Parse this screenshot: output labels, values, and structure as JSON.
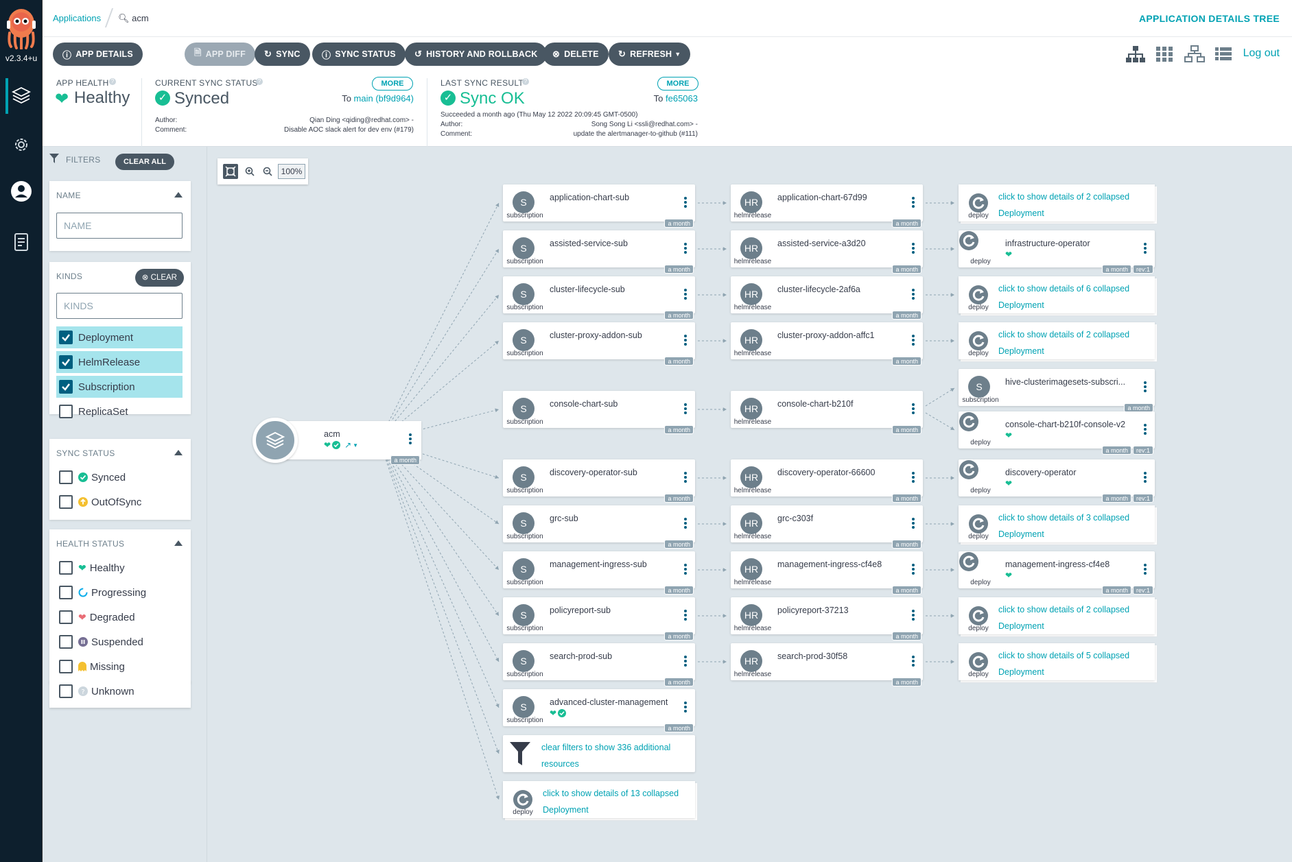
{
  "app": {
    "version": "v2.3.4+u"
  },
  "breadcrumb": {
    "applications": "Applications",
    "search_icon": "search-icon",
    "current": "acm"
  },
  "page_title": "APPLICATION DETAILS TREE",
  "toolbar": {
    "buttons": [
      {
        "label": "APP DETAILS",
        "icon": "info-icon",
        "disabled": false
      },
      {
        "label": "APP DIFF",
        "icon": "file-icon",
        "disabled": true
      },
      {
        "label": "SYNC",
        "icon": "sync-icon",
        "disabled": false
      },
      {
        "label": "SYNC STATUS",
        "icon": "info-icon",
        "disabled": false
      },
      {
        "label": "HISTORY AND ROLLBACK",
        "icon": "history-icon",
        "disabled": false
      },
      {
        "label": "DELETE",
        "icon": "times-circle-icon",
        "disabled": false
      },
      {
        "label": "REFRESH",
        "icon": "redo-icon",
        "disabled": false
      }
    ],
    "logout": "Log out"
  },
  "status": {
    "health_label": "APP HEALTH",
    "health_value": "Healthy",
    "sync_label": "CURRENT SYNC STATUS",
    "sync_value": "Synced",
    "sync_more": "MORE",
    "sync_to_prefix": "To",
    "sync_to": "main (bf9d964)",
    "sync_author_label": "Author:",
    "sync_author": "Qian Ding <qiding@redhat.com> -",
    "sync_comment_label": "Comment:",
    "sync_comment": "Disable AOC slack alert for dev env (#179)",
    "last_label": "LAST SYNC RESULT",
    "last_value": "Sync OK",
    "last_more": "MORE",
    "last_to_prefix": "To",
    "last_to": "fe65063",
    "last_succeeded": "Succeeded a month ago (Thu May 12 2022 20:09:45 GMT-0500)",
    "last_author_label": "Author:",
    "last_author": "Song Song Li <ssli@redhat.com> -",
    "last_comment_label": "Comment:",
    "last_comment": "update the alertmanager-to-github (#111)"
  },
  "filters": {
    "title": "FILTERS",
    "clear_all": "CLEAR ALL",
    "name": {
      "title": "NAME",
      "placeholder": "NAME"
    },
    "kinds": {
      "title": "KINDS",
      "clear": "CLEAR",
      "placeholder": "KINDS",
      "items": [
        {
          "label": "Deployment",
          "checked": true
        },
        {
          "label": "HelmRelease",
          "checked": true
        },
        {
          "label": "Subscription",
          "checked": true
        },
        {
          "label": "ReplicaSet",
          "checked": false
        }
      ]
    },
    "sync_status": {
      "title": "SYNC STATUS",
      "items": [
        {
          "label": "Synced",
          "icon": "check-circle-icon",
          "color": "#18be94"
        },
        {
          "label": "OutOfSync",
          "icon": "arrow-circle-up-icon",
          "color": "#f4c030"
        }
      ]
    },
    "health_status": {
      "title": "HEALTH STATUS",
      "items": [
        {
          "label": "Healthy",
          "icon": "heart-icon",
          "color": "#18be94"
        },
        {
          "label": "Progressing",
          "icon": "circle-notch-icon",
          "color": "#0dadea"
        },
        {
          "label": "Degraded",
          "icon": "heart-broken-icon",
          "color": "#e96d76"
        },
        {
          "label": "Suspended",
          "icon": "pause-circle-icon",
          "color": "#766f94"
        },
        {
          "label": "Missing",
          "icon": "ghost-icon",
          "color": "#f4c030"
        },
        {
          "label": "Unknown",
          "icon": "question-circle-icon",
          "color": "#ccd6dd"
        }
      ]
    }
  },
  "graph": {
    "zoom": "100%",
    "root": {
      "name": "acm",
      "age": "a month"
    },
    "rows": [
      {
        "sub": "application-chart-sub",
        "hr": "application-chart-67d99",
        "deploy": {
          "type": "collapsed",
          "text1": "click to show details of 2 collapsed",
          "text2": "Deployment"
        }
      },
      {
        "sub": "assisted-service-sub",
        "hr": "assisted-service-a3d20",
        "deploy": {
          "type": "node",
          "name": "infrastructure-operator",
          "rev": "rev:1"
        }
      },
      {
        "sub": "cluster-lifecycle-sub",
        "hr": "cluster-lifecycle-2af6a",
        "deploy": {
          "type": "collapsed",
          "text1": "click to show details of 6 collapsed",
          "text2": "Deployment"
        }
      },
      {
        "sub": "cluster-proxy-addon-sub",
        "hr": "cluster-proxy-addon-affc1",
        "deploy": {
          "type": "collapsed",
          "text1": "click to show details of 2 collapsed",
          "text2": "Deployment"
        }
      },
      {
        "sub": "console-chart-sub",
        "hr": "console-chart-b210f",
        "deploy": null
      },
      {
        "sub": "discovery-operator-sub",
        "hr": "discovery-operator-66600",
        "deploy": {
          "type": "node",
          "name": "discovery-operator",
          "rev": "rev:1"
        }
      },
      {
        "sub": "grc-sub",
        "hr": "grc-c303f",
        "deploy": {
          "type": "collapsed",
          "text1": "click to show details of 3 collapsed",
          "text2": "Deployment"
        }
      },
      {
        "sub": "management-ingress-sub",
        "hr": "management-ingress-cf4e8",
        "deploy": {
          "type": "node",
          "name": "management-ingress-cf4e8",
          "rev": "rev:1"
        }
      },
      {
        "sub": "policyreport-sub",
        "hr": "policyreport-37213",
        "deploy": {
          "type": "collapsed",
          "text1": "click to show details of 2 collapsed",
          "text2": "Deployment"
        }
      },
      {
        "sub": "search-prod-sub",
        "hr": "search-prod-30f58",
        "deploy": {
          "type": "collapsed",
          "text1": "click to show details of 5 collapsed",
          "text2": "Deployment"
        }
      }
    ],
    "console_children": [
      {
        "kind_abbr": "S",
        "kind": "subscription",
        "name": "hive-clusterimagesets-subscri..."
      },
      {
        "kind_abbr": "deploy",
        "kind": "deploy",
        "name": "console-chart-b210f-console-v2",
        "rev": "rev:1"
      }
    ],
    "acm_node": {
      "name": "advanced-cluster-management"
    },
    "filter_hint": {
      "text1": "clear filters to show 336 additional",
      "text2": "resources"
    },
    "collapsed_bottom": {
      "text1": "click to show details of 13 collapsed",
      "text2": "Deployment"
    },
    "labels": {
      "subscription": "subscription",
      "helmrelease": "helmrelease",
      "deploy": "deploy",
      "age": "a month",
      "S": "S",
      "HR": "HR"
    }
  },
  "colors": {
    "accent": "#00a2b3",
    "healthy": "#18be94",
    "sidebar": "#0d1f2d",
    "button": "#495763"
  }
}
